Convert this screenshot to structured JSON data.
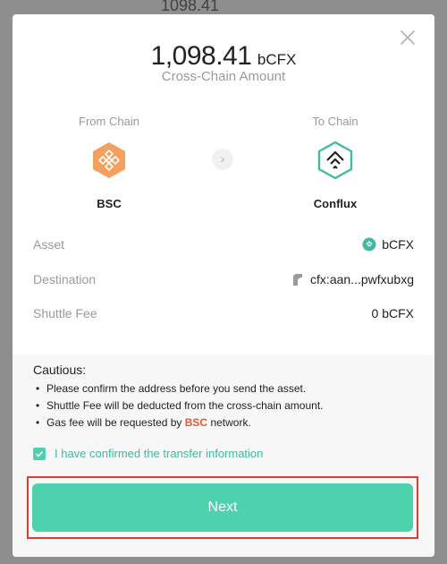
{
  "backdrop": {
    "amount_text": "1098.41"
  },
  "header": {
    "amount": "1,098.41",
    "unit": "bCFX",
    "subtitle": "Cross-Chain Amount"
  },
  "chains": {
    "from_label": "From Chain",
    "from_name": "BSC",
    "to_label": "To Chain",
    "to_name": "Conflux",
    "arrow": "›"
  },
  "details": {
    "asset_label": "Asset",
    "asset_value": "bCFX",
    "destination_label": "Destination",
    "destination_value": "cfx:aan...pwfxubxg",
    "fee_label": "Shuttle Fee",
    "fee_value": "0 bCFX"
  },
  "caution": {
    "title": "Cautious:",
    "item1": "Please confirm the address before you send the asset.",
    "item2": "Shuttle Fee will be deducted from the cross-chain amount.",
    "item3_pre": "Gas fee will be requested by",
    "item3_chain": "BSC",
    "item3_post": "network."
  },
  "confirm": {
    "checked": true,
    "label": "I have confirmed the transfer information"
  },
  "actions": {
    "next_label": "Next"
  },
  "colors": {
    "accent": "#4ed2ae",
    "bsc_orange": "#f5a05f",
    "conflux_teal": "#43b9a1",
    "highlight_red": "#e03b2f"
  }
}
